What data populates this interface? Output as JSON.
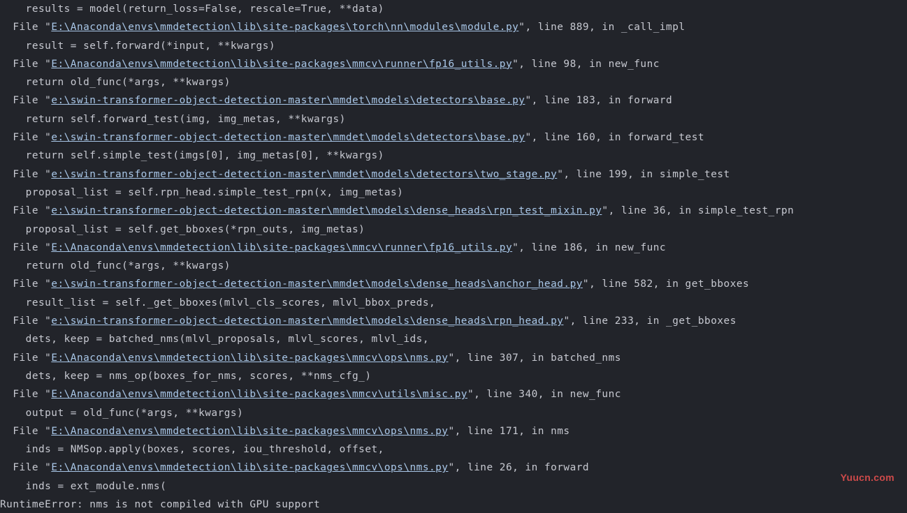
{
  "traceback": [
    {
      "indent": 4,
      "text_before": "",
      "path": "",
      "text_after": "results = model(return_loss=False, rescale=True, **data)"
    },
    {
      "indent": 2,
      "text_before": "File \"",
      "path": "E:\\Anaconda\\envs\\mmdetection\\lib\\site-packages\\torch\\nn\\modules\\module.py",
      "text_after": "\", line 889, in _call_impl"
    },
    {
      "indent": 4,
      "text_before": "",
      "path": "",
      "text_after": "result = self.forward(*input, **kwargs)"
    },
    {
      "indent": 2,
      "text_before": "File \"",
      "path": "E:\\Anaconda\\envs\\mmdetection\\lib\\site-packages\\mmcv\\runner\\fp16_utils.py",
      "text_after": "\", line 98, in new_func"
    },
    {
      "indent": 4,
      "text_before": "",
      "path": "",
      "text_after": "return old_func(*args, **kwargs)"
    },
    {
      "indent": 2,
      "text_before": "File \"",
      "path": "e:\\swin-transformer-object-detection-master\\mmdet\\models\\detectors\\base.py",
      "text_after": "\", line 183, in forward"
    },
    {
      "indent": 4,
      "text_before": "",
      "path": "",
      "text_after": "return self.forward_test(img, img_metas, **kwargs)"
    },
    {
      "indent": 2,
      "text_before": "File \"",
      "path": "e:\\swin-transformer-object-detection-master\\mmdet\\models\\detectors\\base.py",
      "text_after": "\", line 160, in forward_test"
    },
    {
      "indent": 4,
      "text_before": "",
      "path": "",
      "text_after": "return self.simple_test(imgs[0], img_metas[0], **kwargs)"
    },
    {
      "indent": 2,
      "text_before": "File \"",
      "path": "e:\\swin-transformer-object-detection-master\\mmdet\\models\\detectors\\two_stage.py",
      "text_after": "\", line 199, in simple_test"
    },
    {
      "indent": 4,
      "text_before": "",
      "path": "",
      "text_after": "proposal_list = self.rpn_head.simple_test_rpn(x, img_metas)"
    },
    {
      "indent": 2,
      "text_before": "File \"",
      "path": "e:\\swin-transformer-object-detection-master\\mmdet\\models\\dense_heads\\rpn_test_mixin.py",
      "text_after": "\", line 36, in simple_test_rpn"
    },
    {
      "indent": 4,
      "text_before": "",
      "path": "",
      "text_after": "proposal_list = self.get_bboxes(*rpn_outs, img_metas)"
    },
    {
      "indent": 2,
      "text_before": "File \"",
      "path": "E:\\Anaconda\\envs\\mmdetection\\lib\\site-packages\\mmcv\\runner\\fp16_utils.py",
      "text_after": "\", line 186, in new_func"
    },
    {
      "indent": 4,
      "text_before": "",
      "path": "",
      "text_after": "return old_func(*args, **kwargs)"
    },
    {
      "indent": 2,
      "text_before": "File \"",
      "path": "e:\\swin-transformer-object-detection-master\\mmdet\\models\\dense_heads\\anchor_head.py",
      "text_after": "\", line 582, in get_bboxes"
    },
    {
      "indent": 4,
      "text_before": "",
      "path": "",
      "text_after": "result_list = self._get_bboxes(mlvl_cls_scores, mlvl_bbox_preds,"
    },
    {
      "indent": 2,
      "text_before": "File \"",
      "path": "e:\\swin-transformer-object-detection-master\\mmdet\\models\\dense_heads\\rpn_head.py",
      "text_after": "\", line 233, in _get_bboxes"
    },
    {
      "indent": 4,
      "text_before": "",
      "path": "",
      "text_after": "dets, keep = batched_nms(mlvl_proposals, mlvl_scores, mlvl_ids,"
    },
    {
      "indent": 2,
      "text_before": "File \"",
      "path": "E:\\Anaconda\\envs\\mmdetection\\lib\\site-packages\\mmcv\\ops\\nms.py",
      "text_after": "\", line 307, in batched_nms"
    },
    {
      "indent": 4,
      "text_before": "",
      "path": "",
      "text_after": "dets, keep = nms_op(boxes_for_nms, scores, **nms_cfg_)"
    },
    {
      "indent": 2,
      "text_before": "File \"",
      "path": "E:\\Anaconda\\envs\\mmdetection\\lib\\site-packages\\mmcv\\utils\\misc.py",
      "text_after": "\", line 340, in new_func"
    },
    {
      "indent": 4,
      "text_before": "",
      "path": "",
      "text_after": "output = old_func(*args, **kwargs)"
    },
    {
      "indent": 2,
      "text_before": "File \"",
      "path": "E:\\Anaconda\\envs\\mmdetection\\lib\\site-packages\\mmcv\\ops\\nms.py",
      "text_after": "\", line 171, in nms"
    },
    {
      "indent": 4,
      "text_before": "",
      "path": "",
      "text_after": "inds = NMSop.apply(boxes, scores, iou_threshold, offset,"
    },
    {
      "indent": 2,
      "text_before": "File \"",
      "path": "E:\\Anaconda\\envs\\mmdetection\\lib\\site-packages\\mmcv\\ops\\nms.py",
      "text_after": "\", line 26, in forward"
    },
    {
      "indent": 4,
      "text_before": "",
      "path": "",
      "text_after": "inds = ext_module.nms("
    },
    {
      "indent": 0,
      "text_before": "",
      "path": "",
      "text_after": "RuntimeError: nms is not compiled with GPU support"
    }
  ],
  "watermark": "Yuucn.com"
}
